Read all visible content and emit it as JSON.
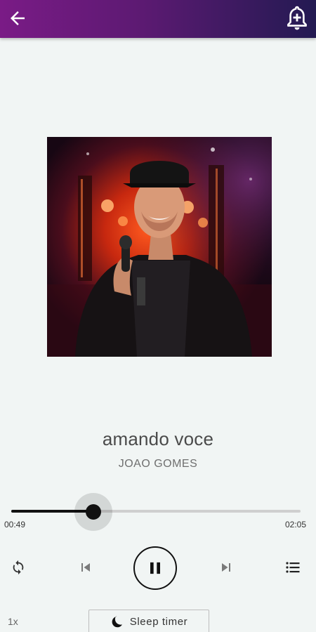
{
  "header": {
    "back_icon": "arrow-left-icon",
    "alarm_icon": "bell-plus-icon",
    "gradient_start": "#7a1b86",
    "gradient_end": "#231a52"
  },
  "album_art": {
    "icon": "album-cover-image"
  },
  "track": {
    "title": "amando voce",
    "artist": "JOAO GOMES"
  },
  "progress": {
    "elapsed": "00:49",
    "total": "02:05",
    "fraction": 0.283
  },
  "controls": {
    "repeat_icon": "repeat-icon",
    "prev_icon": "skip-previous-icon",
    "pause_icon": "pause-icon",
    "next_icon": "skip-next-icon",
    "queue_icon": "queue-list-icon"
  },
  "footer": {
    "speed_label": "1x",
    "sleep_timer_label": "Sleep timer",
    "sleep_icon": "moon-icon"
  }
}
